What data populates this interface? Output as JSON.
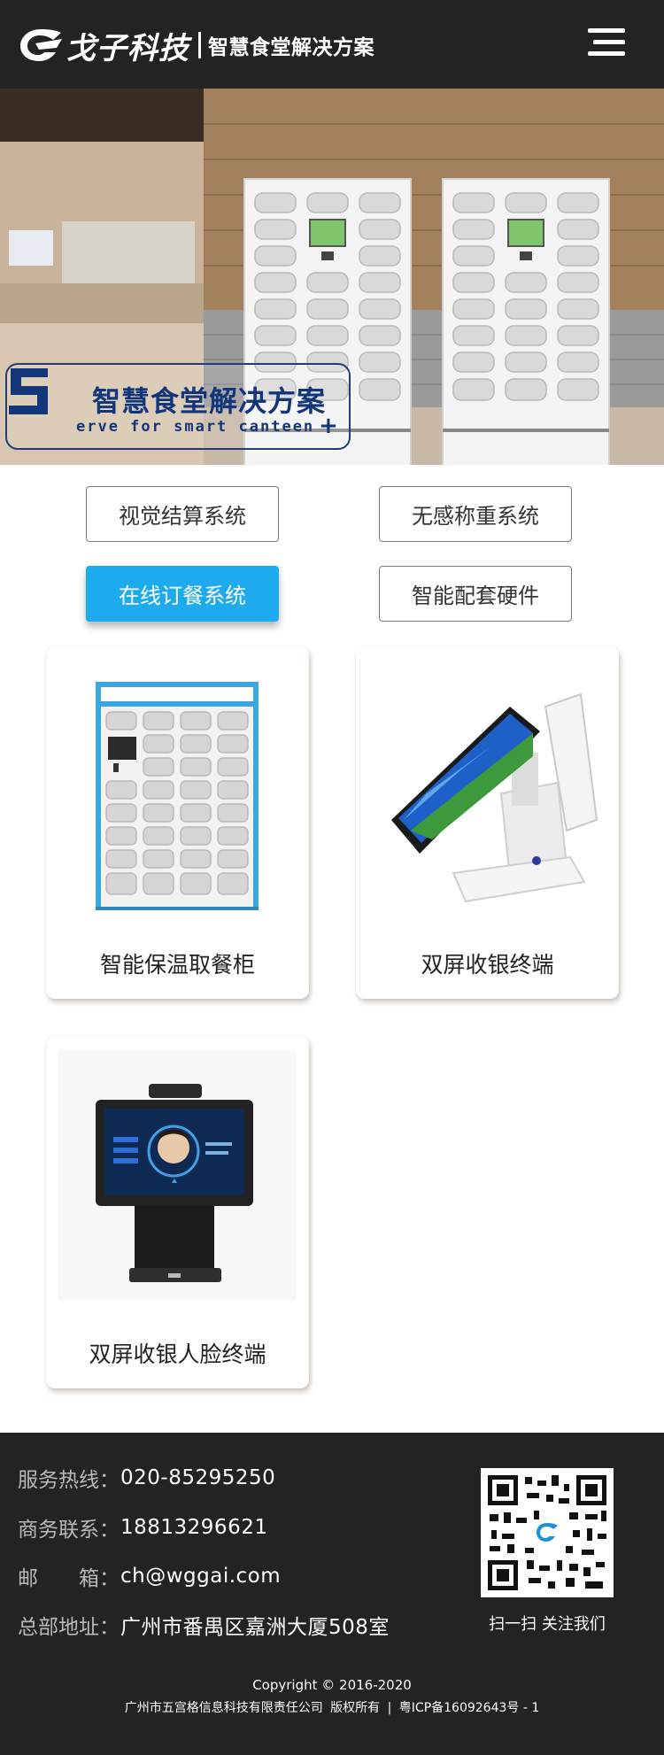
{
  "header": {
    "brand_name": "戈子科技",
    "brand_tagline": "智慧食堂解决方案",
    "menu_icon": "hamburger-menu-icon"
  },
  "banner": {
    "title": "智慧食堂解决方案",
    "subtitle": "erve for smart canteen",
    "letter": "S",
    "plus": "+"
  },
  "tabs": [
    {
      "label": "视觉结算系统",
      "active": false
    },
    {
      "label": "无感称重系统",
      "active": false
    },
    {
      "label": "在线订餐系统",
      "active": true
    },
    {
      "label": "智能配套硬件",
      "active": false
    }
  ],
  "products": [
    {
      "name": "智能保温取餐柜",
      "icon": "food-locker-cabinet"
    },
    {
      "name": "双屏收银终端",
      "icon": "dual-screen-pos-terminal"
    },
    {
      "name": "双屏收银人脸终端",
      "icon": "face-recognition-terminal"
    }
  ],
  "footer": {
    "contacts": [
      {
        "label": "服务热线：",
        "value": "020-85295250"
      },
      {
        "label": "商务联系：",
        "value": "18813296621"
      },
      {
        "label": "邮　　箱：",
        "value": "ch@wggai.com"
      },
      {
        "label": "总部地址：",
        "value": "广州市番禺区嘉洲大厦508室"
      }
    ],
    "qr_caption": "扫一扫 关注我们",
    "copyright": "Copyright © 2016-2020",
    "company": "广州市五宫格信息科技有限责任公司",
    "rights": "版权所有",
    "separator": "|",
    "icp": "粤ICP备16092643号 - 1"
  },
  "colors": {
    "header_bg": "#232323",
    "accent": "#1eaaee",
    "banner_text": "#123679"
  }
}
